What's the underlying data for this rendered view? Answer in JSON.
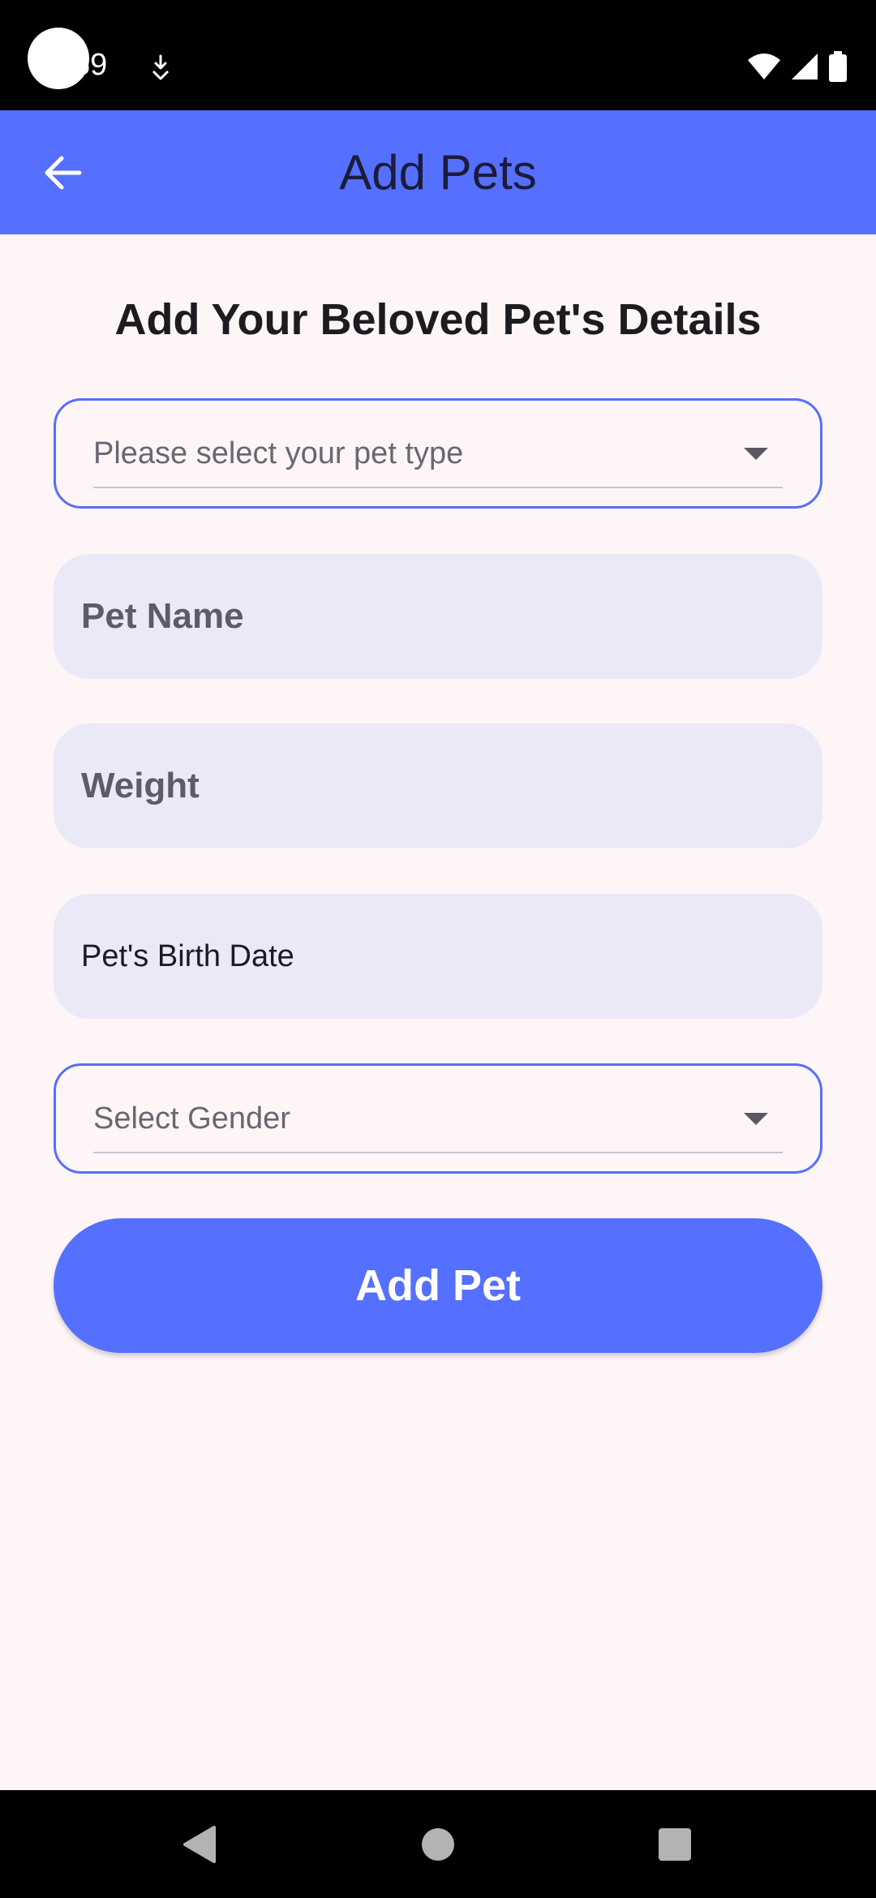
{
  "status_bar": {
    "time": "59",
    "notification_icon": "download-icon",
    "wifi_icon": "wifi-icon",
    "signal_icon": "cell-signal-icon",
    "battery_icon": "battery-icon"
  },
  "app_bar": {
    "title": "Add Pets",
    "back_icon": "arrow-left-icon",
    "background": "#5570FF"
  },
  "form": {
    "heading": "Add Your Beloved Pet's Details",
    "pet_type": {
      "placeholder": "Please select your pet type",
      "icon": "dropdown-caret-icon"
    },
    "pet_name": {
      "label": "Pet Name"
    },
    "weight": {
      "label": "Weight"
    },
    "birth_date": {
      "label": "Pet's Birth Date"
    },
    "gender": {
      "placeholder": "Select Gender",
      "icon": "dropdown-caret-icon"
    },
    "submit_label": "Add Pet"
  },
  "nav_bar": {
    "back_icon": "nav-back-icon",
    "home_icon": "nav-home-icon",
    "recents_icon": "nav-recents-icon"
  },
  "colors": {
    "accent": "#5570FF",
    "background": "#FEF5F7",
    "field_fill": "#EBE8F8"
  }
}
